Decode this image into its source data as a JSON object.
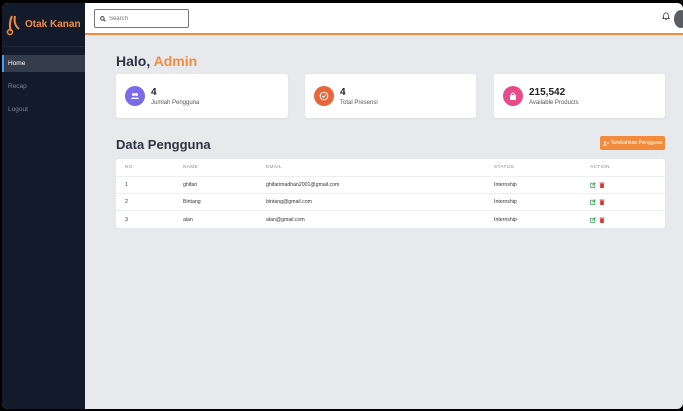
{
  "app": {
    "name": "Otak Kanan"
  },
  "sidebar": {
    "items": [
      {
        "label": "Home"
      },
      {
        "label": "Recap"
      },
      {
        "label": "Logout"
      }
    ]
  },
  "header": {
    "search_placeholder": "Search"
  },
  "greeting": {
    "prefix": "Halo, ",
    "user": "Admin"
  },
  "stats": [
    {
      "value": "4",
      "label": "Jumlah Pengguna",
      "icon": "users-icon",
      "color": "#7b6be8"
    },
    {
      "value": "4",
      "label": "Total Presensi",
      "icon": "check-circle-icon",
      "color": "#e8663a"
    },
    {
      "value": "215,542",
      "label": "Available Products",
      "icon": "shopping-bag-icon",
      "color": "#e84a8a"
    }
  ],
  "section": {
    "title": "Data Pengguna",
    "add_button": "Tambahkan Pengguna"
  },
  "table": {
    "columns": [
      "NO",
      "NAME",
      "EMAIL",
      "STATUS",
      "ACTION"
    ],
    "rows": [
      {
        "no": "1",
        "name": "ghifari",
        "email": "ghifarimadhan2001@gmail.com",
        "status": "Internship"
      },
      {
        "no": "2",
        "name": "Bintang",
        "email": "bintang@gmail.com",
        "status": "Internship"
      },
      {
        "no": "3",
        "name": "alan",
        "email": "alan@gmail.com",
        "status": "Internship"
      }
    ]
  },
  "colors": {
    "accent": "#f28c3c",
    "sidebar": "#131a2b",
    "edit": "#2e9d4f",
    "delete": "#d9302c"
  }
}
